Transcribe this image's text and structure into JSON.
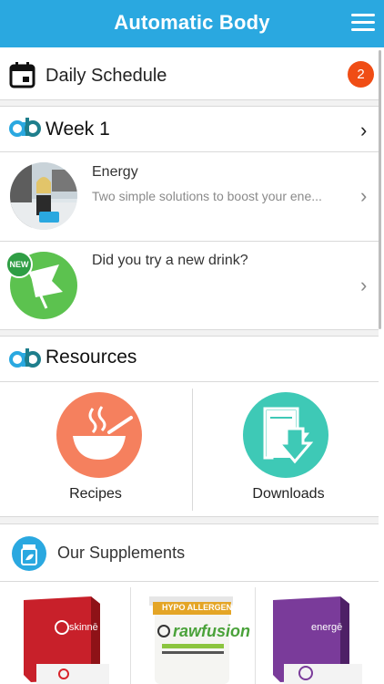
{
  "app": {
    "title": "Automatic Body"
  },
  "schedule": {
    "title": "Daily Schedule",
    "badge_count": "2"
  },
  "week": {
    "title": "Week 1"
  },
  "items": [
    {
      "title": "Energy",
      "subtitle": "Two simple solutions to boost your ene..."
    },
    {
      "title": "Did you try a new drink?",
      "subtitle": "",
      "badge": "NEW"
    }
  ],
  "resources": {
    "title": "Resources",
    "tiles": [
      {
        "label": "Recipes",
        "color": "#f5805e"
      },
      {
        "label": "Downloads",
        "color": "#3ec9b6"
      }
    ]
  },
  "supplements": {
    "title": "Our Supplements",
    "products": [
      {
        "name": "skinnē",
        "color": "#d8232a"
      },
      {
        "name": "rawfusion",
        "banner": "HYPO ALLERGENIC",
        "color": "#8bc53f"
      },
      {
        "name": "energē",
        "color": "#7a3b9a"
      }
    ]
  },
  "colors": {
    "header": "#2aa8e0",
    "badge": "#f04d15",
    "new_badge": "#2f9e44"
  }
}
